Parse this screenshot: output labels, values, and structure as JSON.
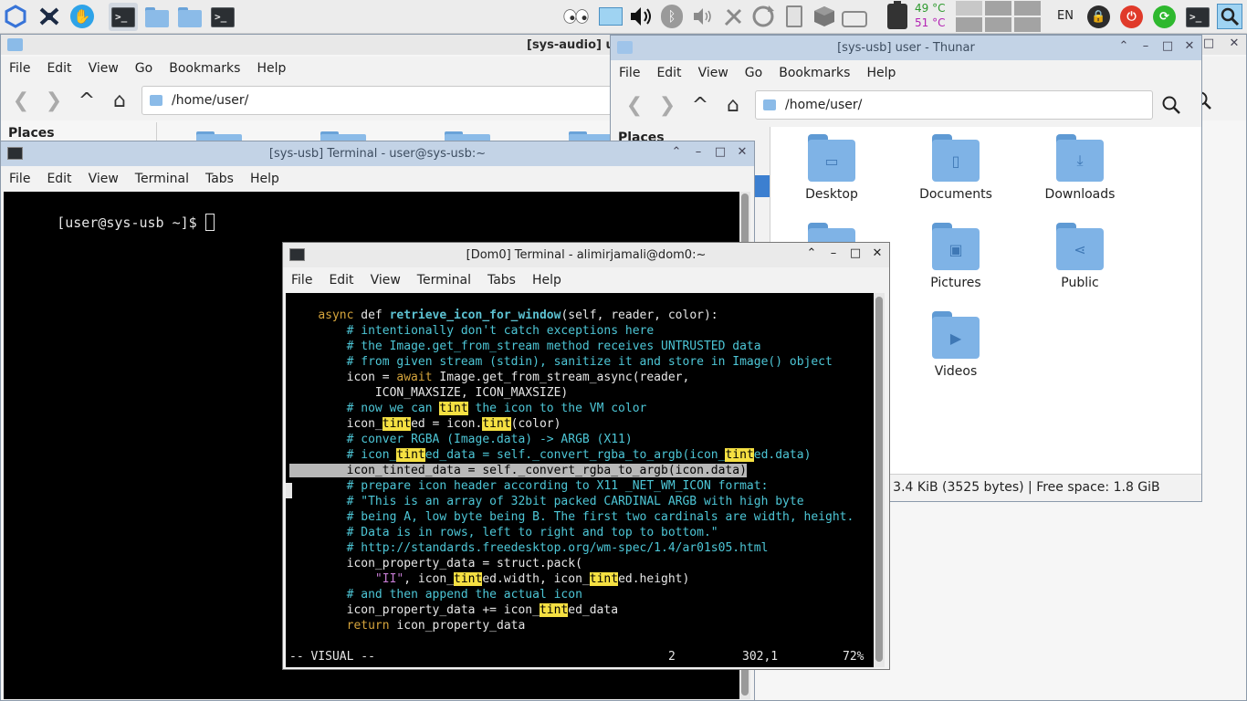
{
  "panel": {
    "temp_cpu": "49 °C",
    "temp_gpu": "51 °C",
    "language": "EN",
    "colors": {
      "temp_cpu": "#2e9a2e",
      "temp_gpu": "#b322b3",
      "shutdown": "#e03a2a",
      "restart": "#2eb82e"
    },
    "icons": [
      "qubes-logo-icon",
      "xfce-icon",
      "qubes-manager-icon",
      "terminal-task-icon",
      "folder-task-icon",
      "folder-task-icon",
      "terminal-task-icon",
      "eyes-icon",
      "screenshot-icon",
      "volume-icon",
      "bluetooth-icon",
      "volume-low-icon",
      "tools-icon",
      "update-icon",
      "clipboard-icon",
      "cube-icon",
      "drive-icon",
      "battery-icon",
      "lock-icon",
      "power-icon",
      "restart-icon",
      "terminal-icon",
      "search-icon"
    ]
  },
  "win_audio": {
    "title": "[sys-audio] user",
    "menu": [
      "File",
      "Edit",
      "View",
      "Go",
      "Bookmarks",
      "Help"
    ],
    "path": "/home/user/",
    "places": "Places"
  },
  "win_thunar": {
    "title": "[sys-usb] user - Thunar",
    "menu": [
      "File",
      "Edit",
      "View",
      "Go",
      "Bookmarks",
      "Help"
    ],
    "path": "/home/user/",
    "places": "Places",
    "folders": [
      {
        "name": "Desktop",
        "icon": "desktop-icon"
      },
      {
        "name": "Documents",
        "icon": "document-icon"
      },
      {
        "name": "Downloads",
        "icon": "download-icon"
      },
      {
        "name": "Pictures",
        "icon": "picture-icon"
      },
      {
        "name": "Public",
        "icon": "share-icon"
      },
      {
        "name": "Videos",
        "icon": "video-icon"
      }
    ],
    "status": ": 3.4 KiB (3525 bytes)  |  Free space: 1.8 GiB"
  },
  "win_usb_term": {
    "title": "[sys-usb] Terminal - user@sys-usb:~",
    "menu": [
      "File",
      "Edit",
      "View",
      "Terminal",
      "Tabs",
      "Help"
    ],
    "prompt": "[user@sys-usb ~]$ "
  },
  "win_dom0_term": {
    "title": "[Dom0] Terminal - alimirjamali@dom0:~",
    "menu": [
      "File",
      "Edit",
      "View",
      "Terminal",
      "Tabs",
      "Help"
    ],
    "code": [
      [
        [
          "    ",
          ""
        ],
        [
          "async",
          "kw"
        ],
        [
          " def ",
          ""
        ],
        [
          "retrieve_icon_for_window",
          "fn"
        ],
        [
          "(self, reader, color):",
          ""
        ]
      ],
      [
        [
          "        ",
          ""
        ],
        [
          "# intentionally don't catch exceptions here",
          "cm"
        ]
      ],
      [
        [
          "        ",
          ""
        ],
        [
          "# the Image.get_from_stream method receives UNTRUSTED data",
          "cm"
        ]
      ],
      [
        [
          "        ",
          ""
        ],
        [
          "# from given stream (stdin), sanitize it and store in Image() object",
          "cm"
        ]
      ],
      [
        [
          "        icon = ",
          ""
        ],
        [
          "await",
          "kw"
        ],
        [
          " Image.get_from_stream_async(reader,",
          ""
        ]
      ],
      [
        [
          "            ICON_MAXSIZE, ICON_MAXSIZE)",
          ""
        ]
      ],
      [
        [
          "        ",
          ""
        ],
        [
          "# now we can ",
          "cm"
        ],
        [
          "tint",
          "hl"
        ],
        [
          " the icon to the VM color",
          "cm"
        ]
      ],
      [
        [
          "        icon_",
          ""
        ],
        [
          "tint",
          "hl"
        ],
        [
          "ed = icon.",
          ""
        ],
        [
          "tint",
          "hl"
        ],
        [
          "(color)",
          ""
        ]
      ],
      [
        [
          "        ",
          ""
        ],
        [
          "# conver RGBA (Image.data) -> ARGB (X11)",
          "cm"
        ]
      ],
      [
        [
          "        ",
          ""
        ],
        [
          "# icon_",
          "cm"
        ],
        [
          "tint",
          "hl"
        ],
        [
          "ed_data = self._convert_rgba_to_argb(icon_",
          "cm"
        ],
        [
          "tint",
          "hl"
        ],
        [
          "ed.data)",
          "cm"
        ]
      ],
      [
        [
          "        icon_tinted_data = self._convert_rgba_to_argb(icon.data)",
          "sel"
        ]
      ],
      [
        [
          "        ",
          ""
        ],
        [
          "# prepare icon header according to X11 _NET_WM_ICON format:",
          "cm"
        ]
      ],
      [
        [
          "        ",
          ""
        ],
        [
          "# \"This is an array of 32bit packed CARDINAL ARGB with high byte",
          "cm"
        ]
      ],
      [
        [
          "        ",
          ""
        ],
        [
          "# being A, low byte being B. The first two cardinals are width, height.",
          "cm"
        ]
      ],
      [
        [
          "        ",
          ""
        ],
        [
          "# Data is in rows, left to right and top to bottom.\"",
          "cm"
        ]
      ],
      [
        [
          "        ",
          ""
        ],
        [
          "# http://standards.freedesktop.org/wm-spec/1.4/ar01s05.html",
          "cm"
        ]
      ],
      [
        [
          "        icon_property_data = struct.pack(",
          ""
        ]
      ],
      [
        [
          "            ",
          ""
        ],
        [
          "\"II\"",
          "st"
        ],
        [
          ", icon_",
          ""
        ],
        [
          "tint",
          "hl"
        ],
        [
          "ed.width, icon_",
          ""
        ],
        [
          "tint",
          "hl"
        ],
        [
          "ed.height)",
          ""
        ]
      ],
      [
        [
          "        ",
          ""
        ],
        [
          "# and then append the actual icon",
          "cm"
        ]
      ],
      [
        [
          "        icon_property_data += icon_",
          ""
        ],
        [
          "tint",
          "hl"
        ],
        [
          "ed_data",
          ""
        ]
      ],
      [
        [
          "        ",
          ""
        ],
        [
          "return",
          "kw"
        ],
        [
          " icon_property_data",
          ""
        ]
      ]
    ],
    "vim_mode": "-- VISUAL --",
    "vim_sel_count": "2",
    "vim_position": "302,1",
    "vim_percent": "72%",
    "colors": {
      "background": "#000000",
      "highlight": "#f5e042",
      "comment": "#4dc6d6",
      "keyword": "#d6a53c"
    }
  }
}
